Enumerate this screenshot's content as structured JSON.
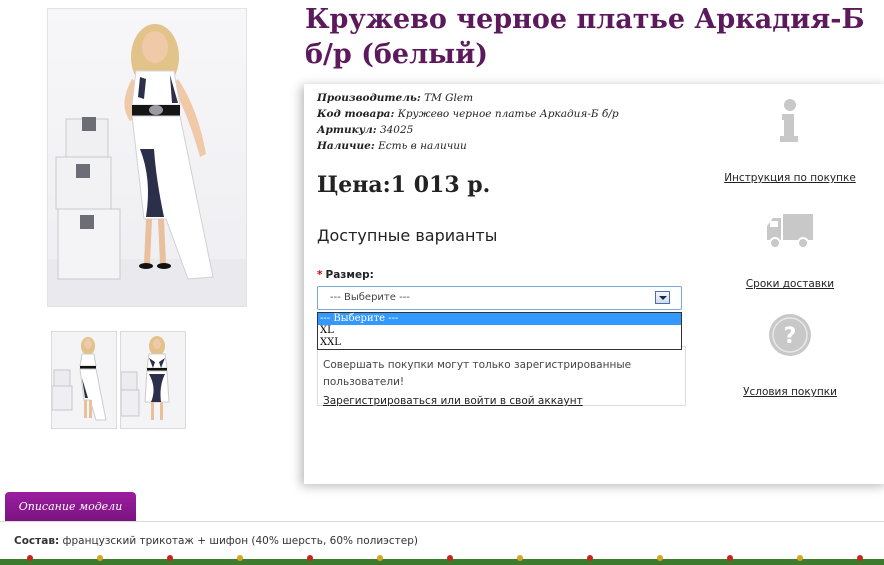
{
  "product": {
    "title": "Кружево черное платье Аркадия-Б б/р (белый)",
    "meta": {
      "manufacturer_label": "Производитель:",
      "manufacturer_value": "ТМ Glem",
      "code_label": "Код товара:",
      "code_value": "Кружево черное платье Аркадия-Б б/р",
      "sku_label": "Артикул:",
      "sku_value": "34025",
      "availability_label": "Наличие:",
      "availability_value": "Есть в наличии"
    },
    "price": "Цена:1 013 р.",
    "variants_heading": "Доступные варианты",
    "size": {
      "required_mark": "*",
      "label": "Размер:",
      "selected": "--- Выберите ---",
      "options": [
        "--- Выберите ---",
        "XL",
        "XXL"
      ]
    },
    "login_notice": "Совершать покупки могут только зарегистрированные пользователи!",
    "login_link": "Зарегистрироваться или войти в свой аккаунт"
  },
  "side_links": {
    "instructions": {
      "label": "Инструкция по покупке",
      "icon": "info-icon"
    },
    "delivery": {
      "label": "Сроки доставки",
      "icon": "truck-icon"
    },
    "terms": {
      "label": "Условия покупки",
      "icon": "question-icon"
    }
  },
  "tabs": {
    "description": "Описание модели"
  },
  "composition": {
    "label": "Состав:",
    "value": "французский трикотаж + шифон (40% шерсть, 60% полиэстер)"
  },
  "colors": {
    "title": "#5c1a5c",
    "tab": "#8c1a91",
    "select_highlight": "#3399ff",
    "icon_gray": "#c8c8c8"
  }
}
